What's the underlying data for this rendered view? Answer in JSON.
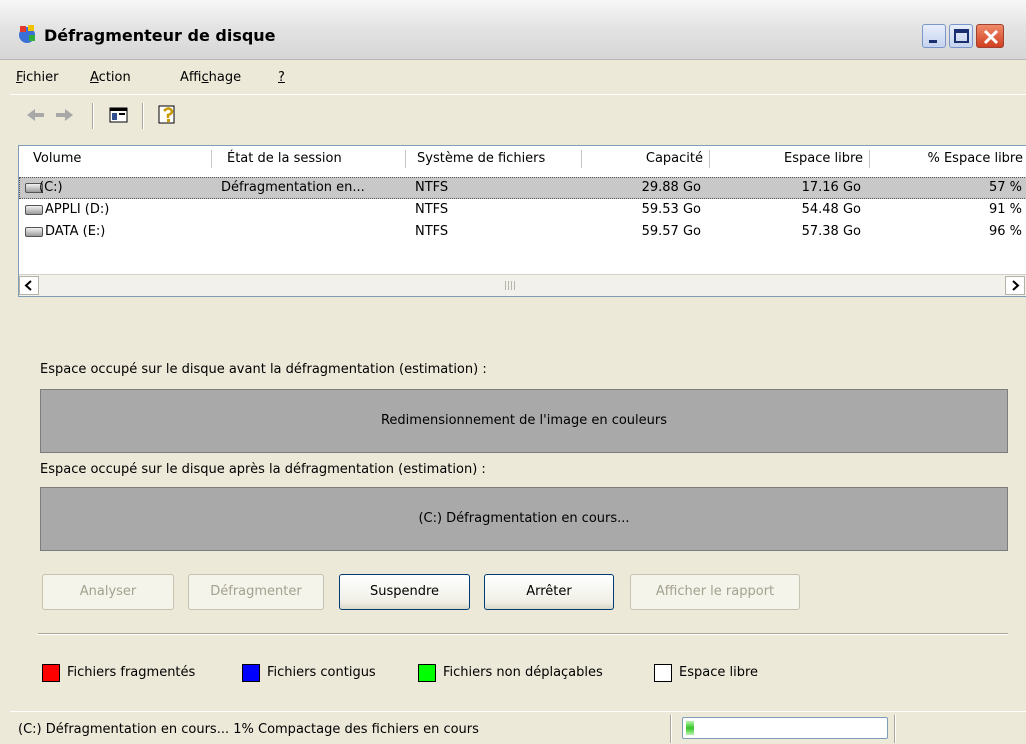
{
  "window": {
    "title": "Défragmenteur de disque"
  },
  "menu": [
    {
      "pre": "",
      "u": "F",
      "post": "ichier"
    },
    {
      "pre": "",
      "u": "A",
      "post": "ction"
    },
    {
      "pre": "Affi",
      "u": "c",
      "post": "hage"
    },
    {
      "pre": "",
      "u": "?",
      "post": ""
    }
  ],
  "toolbar": {
    "icons": [
      "back-arrow-icon",
      "forward-arrow-icon",
      "show-hide-console-tree-icon",
      "help-icon"
    ]
  },
  "columns": {
    "volume": "Volume",
    "session": "État de la session",
    "fs": "Système de fichiers",
    "capacity": "Capacité",
    "free": "Espace libre",
    "pct": "% Espace libre"
  },
  "volumes": [
    {
      "name": "(C:)",
      "session": "Défragmentation en...",
      "fs": "NTFS",
      "capacity": "29.88 Go",
      "free": "17.16 Go",
      "pct": "57 %"
    },
    {
      "name": "APPLI (D:)",
      "session": "",
      "fs": "NTFS",
      "capacity": "59.53 Go",
      "free": "54.48 Go",
      "pct": "91 %"
    },
    {
      "name": "DATA (E:)",
      "session": "",
      "fs": "NTFS",
      "capacity": "59.57 Go",
      "free": "57.38 Go",
      "pct": "96 %"
    }
  ],
  "analysis": {
    "before_label": "Espace occupé sur le disque avant la défragmentation (estimation) :",
    "before_text": "Redimensionnement de l'image en couleurs",
    "after_label": "Espace occupé sur le disque après la défragmentation (estimation) :",
    "after_text": "(C:) Défragmentation en cours..."
  },
  "buttons": {
    "analyze": "Analyser",
    "defrag": "Défragmenter",
    "pause": "Suspendre",
    "stop": "Arrêter",
    "report": "Afficher le rapport"
  },
  "legend": [
    {
      "label": "Fichiers fragmentés",
      "color": "#ff0000"
    },
    {
      "label": "Fichiers contigus",
      "color": "#0000ff"
    },
    {
      "label": "Fichiers non déplaçables",
      "color": "#00ff00"
    },
    {
      "label": "Espace libre",
      "color": "#ffffff"
    }
  ],
  "status": {
    "text": "(C:) Défragmentation en cours... 1%  Compactage des fichiers en cours",
    "progress_percent": 1
  }
}
